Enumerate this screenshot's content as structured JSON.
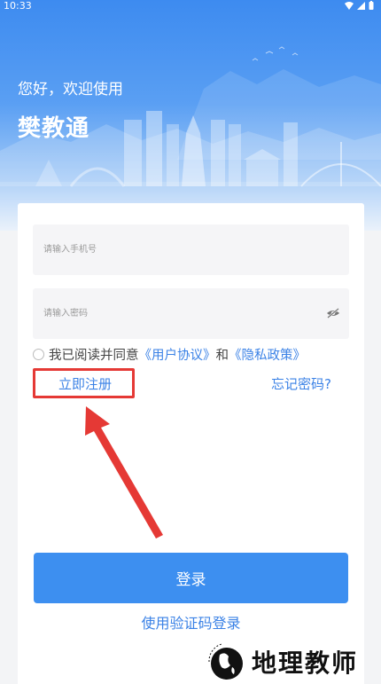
{
  "status_bar": {
    "time": "10:33"
  },
  "header": {
    "greeting": "您好，欢迎使用",
    "app_name": "樊教通"
  },
  "form": {
    "phone_placeholder": "请输入手机号",
    "password_placeholder": "请输入密码",
    "agree_prefix": "我已阅读并同意",
    "user_agreement": "《用户协议》",
    "agree_and": "和",
    "privacy_policy": "《隐私政策》",
    "register": "立即注册",
    "forgot_password": "忘记密码?",
    "login": "登录",
    "sms_login": "使用验证码登录"
  },
  "watermark": {
    "text": "地理教师"
  },
  "colors": {
    "accent": "#3d8ff0",
    "annotation": "#e53935"
  }
}
